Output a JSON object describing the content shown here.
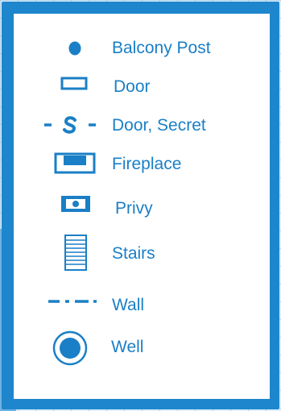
{
  "legend": {
    "accent_color": "#1a7fc6",
    "frame_color": "#1e86cc",
    "items": [
      {
        "label": "Balcony Post",
        "icon": "balcony-post-icon"
      },
      {
        "label": "Door",
        "icon": "door-icon"
      },
      {
        "label": "Door, Secret",
        "icon": "secret-door-icon"
      },
      {
        "label": "Fireplace",
        "icon": "fireplace-icon"
      },
      {
        "label": "Privy",
        "icon": "privy-icon"
      },
      {
        "label": "Stairs",
        "icon": "stairs-icon"
      },
      {
        "label": "Wall",
        "icon": "wall-icon"
      },
      {
        "label": "Well",
        "icon": "well-icon"
      }
    ]
  }
}
